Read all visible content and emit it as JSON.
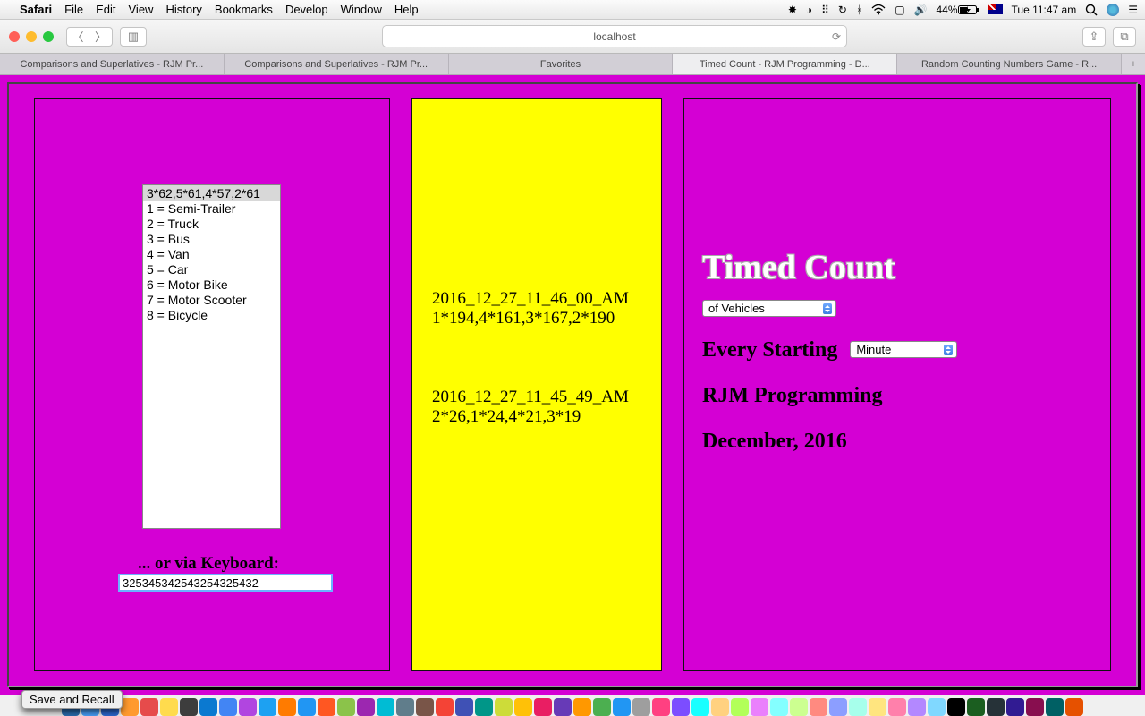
{
  "menubar": {
    "app": "Safari",
    "items": [
      "File",
      "Edit",
      "View",
      "History",
      "Bookmarks",
      "Develop",
      "Window",
      "Help"
    ],
    "battery": "44%",
    "clock": "Tue 11:47 am"
  },
  "toolbar": {
    "address": "localhost"
  },
  "tabs": [
    "Comparisons and Superlatives - RJM Pr...",
    "Comparisons and Superlatives - RJM Pr...",
    "Favorites",
    "Timed Count - RJM Programming - D...",
    "Random Counting Numbers Game - R..."
  ],
  "active_tab": 3,
  "col1": {
    "selected": "3*62,5*61,4*57,2*61",
    "legend": [
      "1 = Semi-Trailer",
      "2 = Truck",
      "3 = Bus",
      "4 = Van",
      "5 = Car",
      "6 = Motor Bike",
      "7 = Motor Scooter",
      "8 = Bicycle"
    ],
    "kb_label": "... or via Keyboard:",
    "kb_value": "325345342543254325432"
  },
  "col2": {
    "e1_ts": "2016_12_27_11_46_00_AM",
    "e1_data": "1*194,4*161,3*167,2*190",
    "e2_ts": "2016_12_27_11_45_49_AM",
    "e2_data": "2*26,1*24,4*21,3*19"
  },
  "col3": {
    "title": "Timed Count",
    "select1": "of Vehicles",
    "line2_a": "Every Starting",
    "select2": "Minute",
    "line3": "RJM Programming",
    "line4": "December, 2016"
  },
  "save_button": "Save and Recall",
  "dock_colors": [
    "#2b6fb3",
    "#4aa3ff",
    "#2d6bd6",
    "#ff9a2e",
    "#e64b4b",
    "#ffdb4d",
    "#3d3d3d",
    "#0b79d0",
    "#4285f4",
    "#b145e0",
    "#1da1f2",
    "#ff7b00",
    "#2196f3",
    "#ff5722",
    "#8bc34a",
    "#9c27b0",
    "#00bcd4",
    "#607d8b",
    "#795548",
    "#f44336",
    "#3f51b5",
    "#009688",
    "#cddc39",
    "#ffc107",
    "#e91e63",
    "#673ab7",
    "#ff9800",
    "#4caf50",
    "#2196f3",
    "#9e9e9e",
    "#ff4081",
    "#7c4dff",
    "#18ffff",
    "#ffd180",
    "#b2ff59",
    "#ea80fc",
    "#84ffff",
    "#ccff90",
    "#ff8a80",
    "#8c9eff",
    "#a7ffeb",
    "#ffe57f",
    "#ff80ab",
    "#b388ff",
    "#80d8ff",
    "#000",
    "#1b5e20",
    "#263238",
    "#311b92",
    "#880e4f",
    "#006064",
    "#e65100"
  ]
}
